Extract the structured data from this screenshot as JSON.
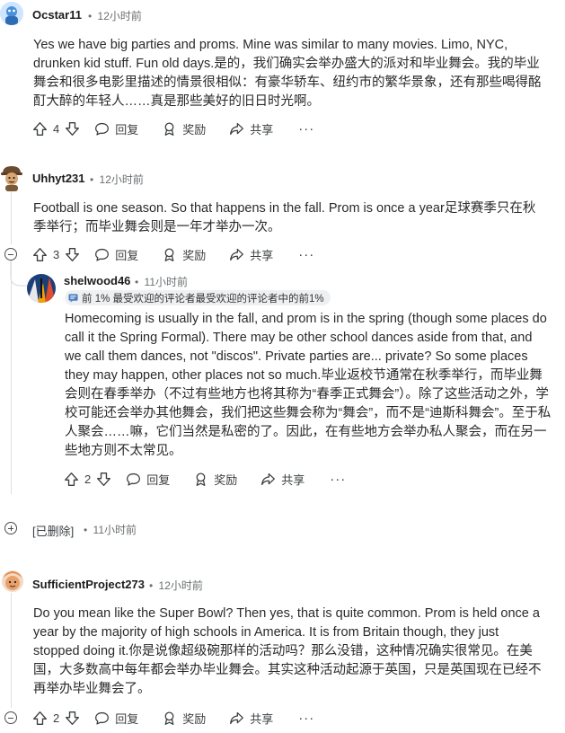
{
  "comments": [
    {
      "author": "Ocstar11",
      "time": "12小时前",
      "body": "Yes we have big parties and proms. Mine was similar to many movies. Limo, NYC, drunken kid stuff. Fun old days.是的，我们确实会举办盛大的派对和毕业舞会。我的毕业舞会和很多电影里描述的情景很相似：有豪华轿车、纽约市的繁华景象，还有那些喝得酩酊大醉的年轻人……真是那些美好的旧日时光啊。",
      "votes": "4",
      "reply": "回复",
      "award": "奖励",
      "share": "共享",
      "more": "···"
    },
    {
      "author": "Uhhyt231",
      "time": "12小时前",
      "body": "Football is one season. So that happens in the fall. Prom is once a year足球赛季只在秋季举行；而毕业舞会则是一年才举办一次。",
      "votes": "3",
      "reply": "回复",
      "award": "奖励",
      "share": "共享",
      "more": "···"
    },
    {
      "author": "shelwood46",
      "time": "11小时前",
      "flair": "前 1% 最受欢迎的评论者最受欢迎的评论者中的前1%",
      "body": "Homecoming is usually in the fall, and prom is in the spring (though some places do call it the Spring Formal). There may be other school dances aside from that, and we call them dances, not \"discos\". Private parties are... private? So some places they may happen, other places not so much.毕业返校节通常在秋季举行，而毕业舞会则在春季举办（不过有些地方也将其称为“春季正式舞会”）。除了这些活动之外，学校可能还会举办其他舞会，我们把这些舞会称为“舞会”，而不是“迪斯科舞会”。至于私人聚会……嘛，它们当然是私密的了。因此，在有些地方会举办私人聚会，而在另一些地方则不太常见。",
      "votes": "2",
      "reply": "回复",
      "award": "奖励",
      "share": "共享",
      "more": "···"
    },
    {
      "author": "[已删除]",
      "time": "11小时前"
    },
    {
      "author": "SufficientProject273",
      "time": "12小时前",
      "body": "Do you mean like the Super Bowl? Then yes, that is quite common. Prom is held once a year by the majority of high schools in America. It is from Britain though, they just stopped doing it.你是说像超级碗那样的活动吗？那么没错，这种情况确实很常见。在美国，大多数高中每年都会举办毕业舞会。其实这种活动起源于英国，只是英国现在已经不再举办毕业舞会了。",
      "votes": "2",
      "reply": "回复",
      "award": "奖励",
      "share": "共享",
      "more": "···"
    }
  ],
  "separator": "•"
}
